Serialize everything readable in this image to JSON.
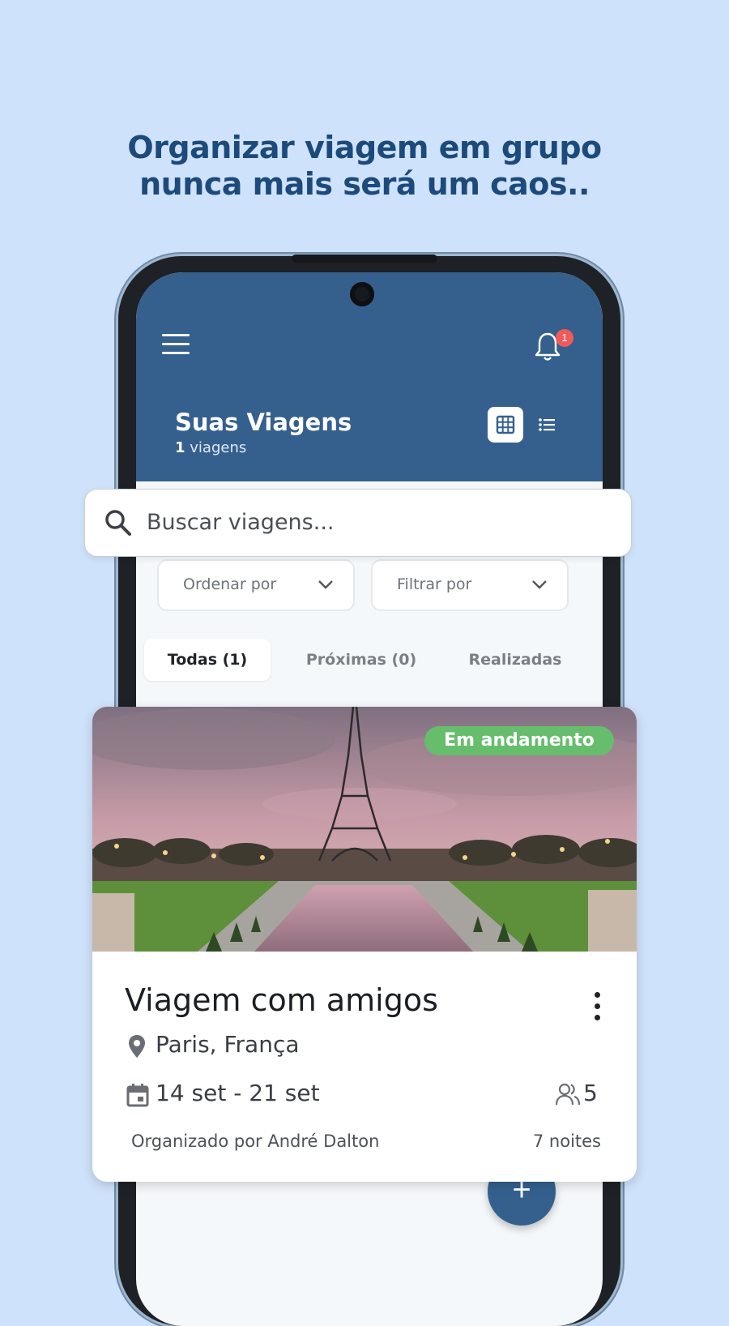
{
  "headline": {
    "line1": "Organizar viagem em grupo",
    "line2": "nunca mais será um caos.."
  },
  "app": {
    "notification_count": "1",
    "title": "Suas Viagens",
    "trip_count_number": "1",
    "trip_count_label": "viagens",
    "view_modes": [
      "grid-icon",
      "list-icon"
    ],
    "colors": {
      "header": "#35608e",
      "badge": "#f05a5a",
      "status": "#66bd6c",
      "background": "#cfe2fb"
    }
  },
  "search": {
    "placeholder": "Buscar viagens..."
  },
  "filters": {
    "sort_label": "Ordenar por",
    "filter_label": "Filtrar por"
  },
  "tabs": [
    {
      "label": "Todas (1)",
      "active": true
    },
    {
      "label": "Próximas (0)",
      "active": false
    },
    {
      "label": "Realizadas",
      "active": false
    }
  ],
  "trip": {
    "status": "Em andamento",
    "title": "Viagem com amigos",
    "location": "Paris, França",
    "dates": "14 set - 21 set",
    "participants": "5",
    "organizer": "Organizado por André Dalton",
    "nights": "7 noites",
    "photo": "eiffel-tower-photo"
  },
  "fab": {
    "label": "+"
  }
}
